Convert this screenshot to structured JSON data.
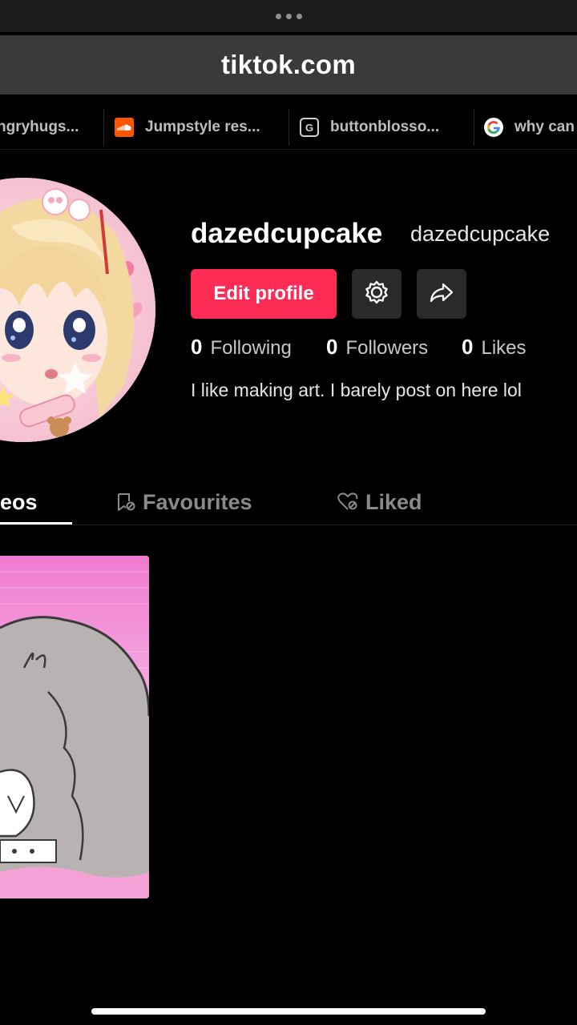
{
  "browser": {
    "url": "tiktok.com",
    "bookmarks": [
      {
        "label": "ngryhugs...",
        "icon": "globe-icon"
      },
      {
        "label": "Jumpstyle res...",
        "icon": "soundcloud-icon"
      },
      {
        "label": "buttonblosso...",
        "icon": "g-tile-icon"
      },
      {
        "label": "why can",
        "icon": "google-icon"
      }
    ]
  },
  "profile": {
    "username": "dazedcupcake",
    "nickname": "dazedcupcake",
    "edit_label": "Edit profile",
    "bio": "I like making art. I barely post on here lol",
    "stats": {
      "following_count": "0",
      "following_label": "Following",
      "followers_count": "0",
      "followers_label": "Followers",
      "likes_count": "0",
      "likes_label": "Likes"
    }
  },
  "tabs": {
    "videos": "eos",
    "favourites": "Favourites",
    "liked": "Liked"
  },
  "colors": {
    "accent": "#fe2c55",
    "background": "#000000",
    "url_bar": "#3a3a3c"
  }
}
